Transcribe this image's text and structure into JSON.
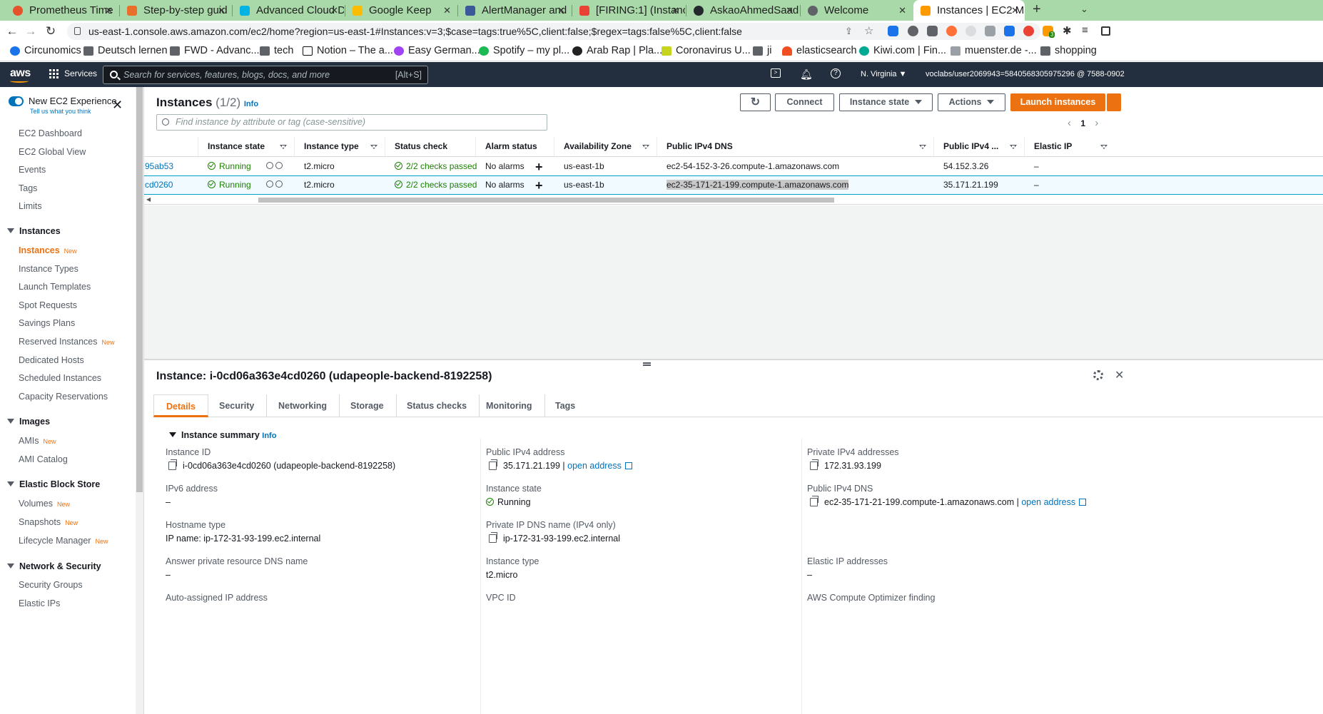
{
  "browser": {
    "tabs": [
      {
        "title": "Prometheus Time",
        "color": "#e6522c"
      },
      {
        "title": "Step-by-step guid",
        "color": "#e8702a"
      },
      {
        "title": "Advanced Cloud D",
        "color": "#02b3e4"
      },
      {
        "title": "Google Keep",
        "color": "#fbbc04"
      },
      {
        "title": "AlertManager and",
        "color": "#3b5998"
      },
      {
        "title": "[FIRING:1] (Instanc",
        "color": "#ea4335"
      },
      {
        "title": "AskaoAhmedSaad",
        "color": "#24292e"
      },
      {
        "title": "Welcome",
        "color": "#5f6368"
      },
      {
        "title": "Instances | EC2 Ma",
        "color": "#f90"
      }
    ],
    "url": "us-east-1.console.aws.amazon.com/ec2/home?region=us-east-1#Instances:v=3;$case=tags:true%5C,client:false;$regex=tags:false%5C,client:false",
    "bookmarks": [
      "Circunomics",
      "Deutsch lernen",
      "FWD - Advanc...",
      "tech",
      "Notion – The a...",
      "Easy German...",
      "Spotify – my pl...",
      "Arab Rap | Pla...",
      "Coronavirus U...",
      "ji",
      "elasticsearch",
      "Kiwi.com | Fin...",
      "muenster.de -...",
      "shopping"
    ],
    "ext_badge": "3"
  },
  "aws": {
    "logo": "aws",
    "services": "Services",
    "search_placeholder": "Search for services, features, blogs, docs, and more",
    "search_shortcut": "[Alt+S]",
    "region": "N. Virginia",
    "account": "voclabs/user2069943=5840568305975296 @ 7588-0902"
  },
  "sidebar": {
    "new_experience": "New EC2 Experience",
    "tell_us": "Tell us what you think",
    "top_items": [
      "EC2 Dashboard",
      "EC2 Global View",
      "Events",
      "Tags",
      "Limits"
    ],
    "instances_header": "Instances",
    "instances_items": [
      {
        "label": "Instances",
        "badge": "New"
      },
      {
        "label": "Instance Types",
        "badge": ""
      },
      {
        "label": "Launch Templates",
        "badge": ""
      },
      {
        "label": "Spot Requests",
        "badge": ""
      },
      {
        "label": "Savings Plans",
        "badge": ""
      },
      {
        "label": "Reserved Instances",
        "badge": "New"
      },
      {
        "label": "Dedicated Hosts",
        "badge": ""
      },
      {
        "label": "Scheduled Instances",
        "badge": ""
      },
      {
        "label": "Capacity Reservations",
        "badge": ""
      }
    ],
    "images_header": "Images",
    "images_items": [
      {
        "label": "AMIs",
        "badge": "New"
      },
      {
        "label": "AMI Catalog",
        "badge": ""
      }
    ],
    "ebs_header": "Elastic Block Store",
    "ebs_items": [
      {
        "label": "Volumes",
        "badge": "New"
      },
      {
        "label": "Snapshots",
        "badge": "New"
      },
      {
        "label": "Lifecycle Manager",
        "badge": "New"
      }
    ],
    "netsec_header": "Network & Security",
    "netsec_items": [
      "Security Groups",
      "Elastic IPs"
    ]
  },
  "instances": {
    "title": "Instances",
    "count": "(1/2)",
    "info": "Info",
    "connect": "Connect",
    "instance_state": "Instance state",
    "actions": "Actions",
    "launch": "Launch instances",
    "filter_placeholder": "Find instance by attribute or tag (case-sensitive)",
    "page": "1",
    "columns": [
      "Instance state",
      "Instance type",
      "Status check",
      "Alarm status",
      "Availability Zone",
      "Public IPv4 DNS",
      "Public IPv4 ...",
      "Elastic IP"
    ],
    "rows": [
      {
        "id": "95ab53",
        "state": "Running",
        "type": "t2.micro",
        "status": "2/2 checks passed",
        "alarm": "No alarms",
        "az": "us-east-1b",
        "dns": "ec2-54-152-3-26.compute-1.amazonaws.com",
        "ip": "54.152.3.26",
        "eip": "–"
      },
      {
        "id": "cd0260",
        "state": "Running",
        "type": "t2.micro",
        "status": "2/2 checks passed",
        "alarm": "No alarms",
        "az": "us-east-1b",
        "dns": "ec2-35-171-21-199.compute-1.amazonaws.com",
        "ip": "35.171.21.199",
        "eip": "–"
      }
    ]
  },
  "detail": {
    "title": "Instance: i-0cd06a363e4cd0260 (udapeople-backend-8192258)",
    "tabs": [
      "Details",
      "Security",
      "Networking",
      "Storage",
      "Status checks",
      "Monitoring",
      "Tags"
    ],
    "summary": "Instance summary",
    "info": "Info",
    "open_address": "open address",
    "col1": [
      {
        "label": "Instance ID",
        "value": "i-0cd06a363e4cd0260 (udapeople-backend-8192258)"
      },
      {
        "label": "IPv6 address",
        "value": "–"
      },
      {
        "label": "Hostname type",
        "value": "IP name: ip-172-31-93-199.ec2.internal"
      },
      {
        "label": "Answer private resource DNS name",
        "value": "–"
      },
      {
        "label": "Auto-assigned IP address",
        "value": ""
      }
    ],
    "col2": [
      {
        "label": "Public IPv4 address",
        "value": "35.171.21.199"
      },
      {
        "label": "Instance state",
        "value": "Running"
      },
      {
        "label": "Private IP DNS name (IPv4 only)",
        "value": "ip-172-31-93-199.ec2.internal"
      },
      {
        "label": "Instance type",
        "value": "t2.micro"
      },
      {
        "label": "VPC ID",
        "value": ""
      }
    ],
    "col3": [
      {
        "label": "Private IPv4 addresses",
        "value": "172.31.93.199"
      },
      {
        "label": "Public IPv4 DNS",
        "value": "ec2-35-171-21-199.compute-1.amazonaws.com"
      },
      {
        "label": "Elastic IP addresses",
        "value": "–"
      },
      {
        "label": "AWS Compute Optimizer finding",
        "value": ""
      }
    ]
  }
}
